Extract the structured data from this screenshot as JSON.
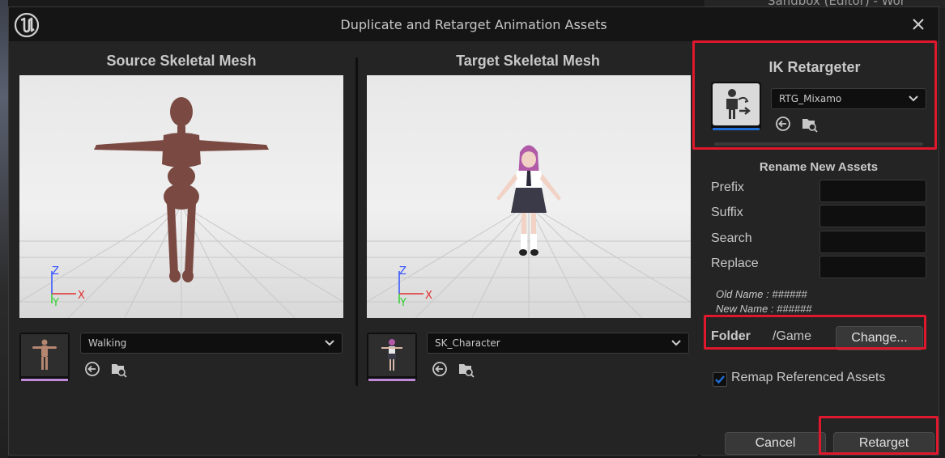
{
  "dialog": {
    "title": "Duplicate and Retarget Animation Assets",
    "background_title": "Sandbox (Editor) - Wor"
  },
  "source": {
    "title": "Source Skeletal Mesh",
    "selected_animation": "Walking",
    "axis_labels": {
      "z": "Z",
      "y": "Y",
      "x": "X"
    }
  },
  "target": {
    "title": "Target Skeletal Mesh",
    "selected_mesh": "SK_Character",
    "axis_labels": {
      "z": "Z",
      "y": "Y",
      "x": "X"
    }
  },
  "ik_retargeter": {
    "title": "IK Retargeter",
    "selected": "RTG_Mixamo"
  },
  "rename": {
    "title": "Rename New Assets",
    "fields": [
      {
        "label": "Prefix",
        "value": ""
      },
      {
        "label": "Suffix",
        "value": ""
      },
      {
        "label": "Search",
        "value": ""
      },
      {
        "label": "Replace",
        "value": ""
      }
    ],
    "old_name": "Old Name : ######",
    "new_name": "New Name : ######"
  },
  "folder": {
    "label": "Folder",
    "value": "/Game",
    "change_label": "Change..."
  },
  "remap": {
    "label": "Remap Referenced Assets",
    "checked": true
  },
  "buttons": {
    "cancel": "Cancel",
    "retarget": "Retarget"
  },
  "colors": {
    "highlight": "#e0182d",
    "accent_blue": "#1f6ed8",
    "axis_x": "#e03030",
    "axis_y": "#30d030",
    "axis_z": "#3050ff"
  },
  "icons": {
    "use_selected": "arrow-left-circle-icon",
    "browse": "folder-search-icon",
    "close": "close-icon",
    "dropdown": "chevron-down-icon"
  }
}
